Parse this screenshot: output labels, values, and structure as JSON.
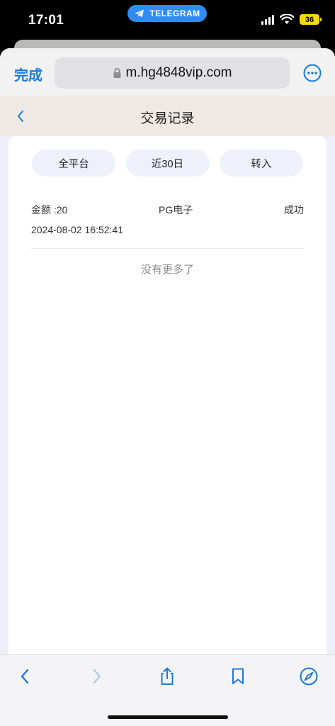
{
  "status_bar": {
    "time": "17:01",
    "telegram_label": "TELEGRAM",
    "battery_level": "36",
    "icons": [
      "signal-icon",
      "wifi-icon",
      "battery-icon"
    ]
  },
  "browser": {
    "done_label": "完成",
    "url": "m.hg4848vip.com",
    "icons": [
      "lock-icon",
      "more-icon"
    ]
  },
  "app_nav": {
    "title": "交易记录",
    "back_icon": "chevron-left-icon"
  },
  "filters": [
    {
      "label": "全平台"
    },
    {
      "label": "近30日"
    },
    {
      "label": "转入"
    }
  ],
  "records": [
    {
      "amount": "金额 :20",
      "platform": "PG电子",
      "status": "成功",
      "time": "2024-08-02 16:52:41"
    }
  ],
  "no_more_text": "没有更多了",
  "toolbar": {
    "icons": [
      "back-icon",
      "forward-icon",
      "share-icon",
      "bookmarks-icon",
      "compass-icon"
    ]
  },
  "colors": {
    "accent": "#1a7ad9",
    "telegram": "#2f8cf0",
    "battery": "#f5d90a",
    "pill_bg": "#eef1fa"
  }
}
